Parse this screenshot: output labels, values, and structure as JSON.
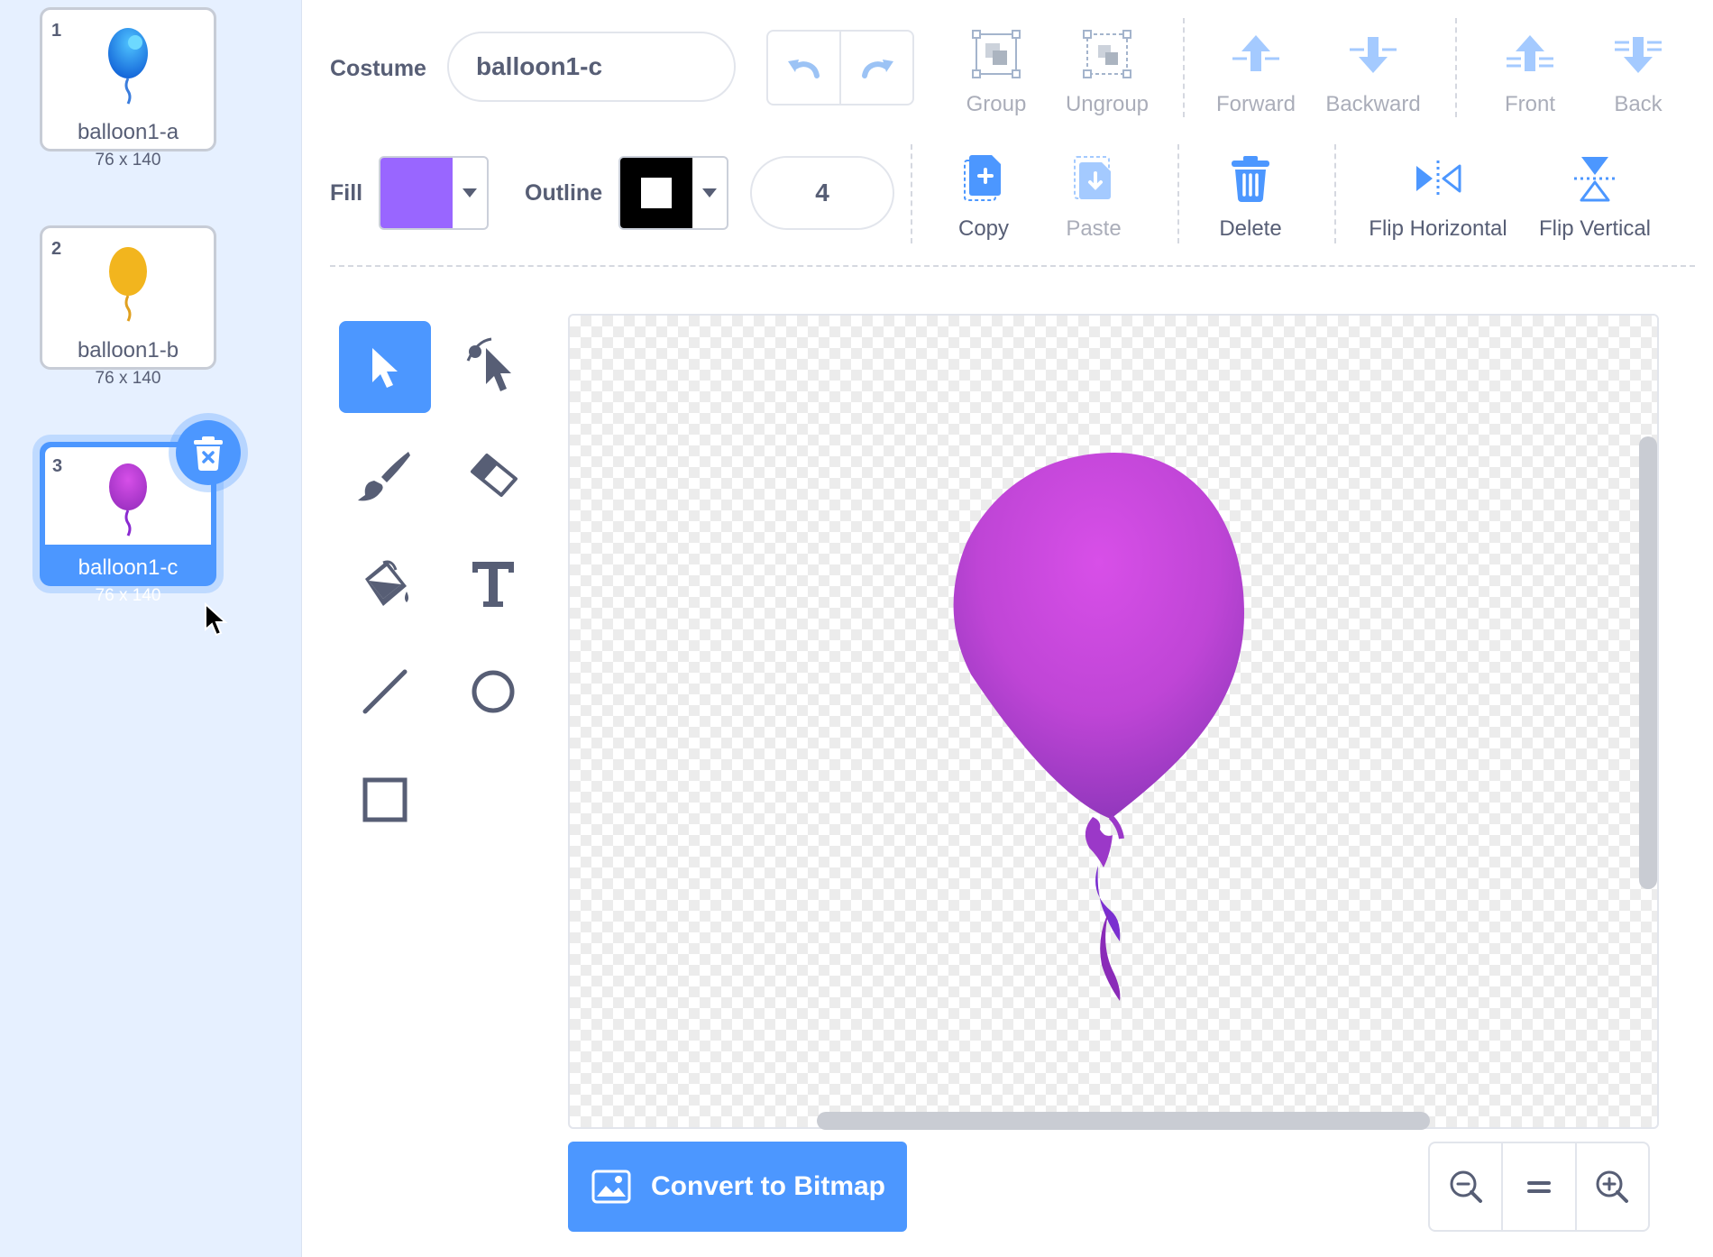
{
  "costumes": [
    {
      "index": "1",
      "name": "balloon1-a",
      "size": "76 x 140",
      "color": "#1e90f0"
    },
    {
      "index": "2",
      "name": "balloon1-b",
      "size": "76 x 140",
      "color": "#f2b51e"
    },
    {
      "index": "3",
      "name": "balloon1-c",
      "size": "76 x 140",
      "color": "#c23fd8",
      "selected": true
    }
  ],
  "toolbar": {
    "costume_label": "Costume",
    "costume_name": "balloon1-c",
    "group": "Group",
    "ungroup": "Ungroup",
    "forward": "Forward",
    "backward": "Backward",
    "front": "Front",
    "back": "Back",
    "fill_label": "Fill",
    "fill_color": "#9966ff",
    "outline_label": "Outline",
    "outline_color": "#000000",
    "outline_width": "4",
    "copy": "Copy",
    "paste": "Paste",
    "delete": "Delete",
    "flip_horizontal": "Flip Horizontal",
    "flip_vertical": "Flip Vertical"
  },
  "tools": [
    "select-tool",
    "reshape-tool",
    "brush-tool",
    "eraser-tool",
    "fill-tool",
    "text-tool",
    "line-tool",
    "circle-tool",
    "rectangle-tool"
  ],
  "canvas": {
    "shape": "purple balloon",
    "color": "#c23fd8"
  },
  "footer": {
    "convert_label": "Convert to Bitmap"
  },
  "zoom": {
    "out": "zoom-out-icon",
    "reset": "zoom-reset-icon",
    "in": "zoom-in-icon"
  }
}
